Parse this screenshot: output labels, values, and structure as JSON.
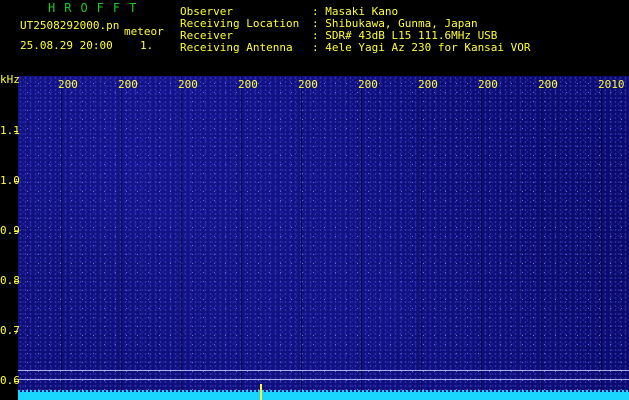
{
  "header": {
    "brand": "HROFFT",
    "file_name": "UT2508292000.pn",
    "meteor_label": "meteor",
    "datetime": "25.08.29 20:00",
    "count": "1.",
    "fields": [
      {
        "label": "Observer",
        "value": ": Masaki Kano"
      },
      {
        "label": "Receiving Location",
        "value": ": Shibukawa, Gunma, Japan"
      },
      {
        "label": "Receiver",
        "value": ": SDR# 43dB L15 111.6MHz USB"
      },
      {
        "label": "Receiving Antenna",
        "value": ": 4ele Yagi Az 230 for Kansai VOR"
      }
    ]
  },
  "axis": {
    "y_unit": "kHz",
    "y_ticks": [
      "1.1",
      "1.0",
      "0.9",
      "0.8",
      "0.7",
      "0.6"
    ],
    "x_ticks": [
      "200",
      "200",
      "200",
      "200",
      "200",
      "200",
      "200",
      "200",
      "200",
      "2010"
    ]
  },
  "colors": {
    "label": "#ffff32",
    "brand": "#1ec81e",
    "spectrum_bg": "#0a0a66",
    "baseline": "#19d6ff"
  }
}
